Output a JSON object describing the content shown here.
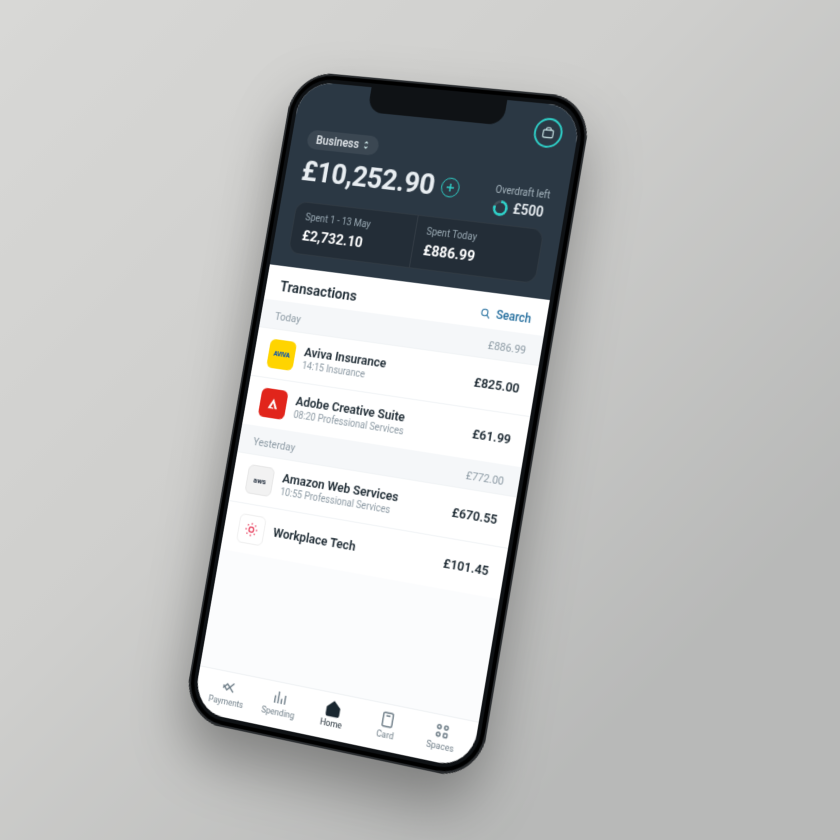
{
  "header": {
    "account_label": "Business",
    "balance": "£10,252.90",
    "overdraft_label": "Overdraft left",
    "overdraft_value": "£500"
  },
  "spent": {
    "period_label": "Spent 1 - 13 May",
    "period_value": "£2,732.10",
    "today_label": "Spent Today",
    "today_value": "£886.99"
  },
  "transactions": {
    "title": "Transactions",
    "search_label": "Search",
    "groups": [
      {
        "label": "Today",
        "total": "£886.99",
        "rows": [
          {
            "name": "Aviva Insurance",
            "time": "14:15",
            "category": "Insurance",
            "amount": "£825.00",
            "icon": "aviva"
          },
          {
            "name": "Adobe Creative Suite",
            "time": "08:20",
            "category": "Professional Services",
            "amount": "£61.99",
            "icon": "adobe"
          }
        ]
      },
      {
        "label": "Yesterday",
        "total": "£772.00",
        "rows": [
          {
            "name": "Amazon Web Services",
            "time": "10:55",
            "category": "Professional Services",
            "amount": "£670.55",
            "icon": "aws"
          },
          {
            "name": "Workplace Tech",
            "time": "",
            "category": "",
            "amount": "£101.45",
            "icon": "workplace"
          }
        ]
      }
    ]
  },
  "nav": {
    "items": [
      {
        "label": "Payments",
        "icon": "payments",
        "active": false
      },
      {
        "label": "Spending",
        "icon": "spending",
        "active": false
      },
      {
        "label": "Home",
        "icon": "home",
        "active": true
      },
      {
        "label": "Card",
        "icon": "card",
        "active": false
      },
      {
        "label": "Spaces",
        "icon": "spaces",
        "active": false
      }
    ]
  },
  "icon_glyphs": {
    "aviva": "AVIVA",
    "adobe": "A",
    "aws": "aws"
  }
}
